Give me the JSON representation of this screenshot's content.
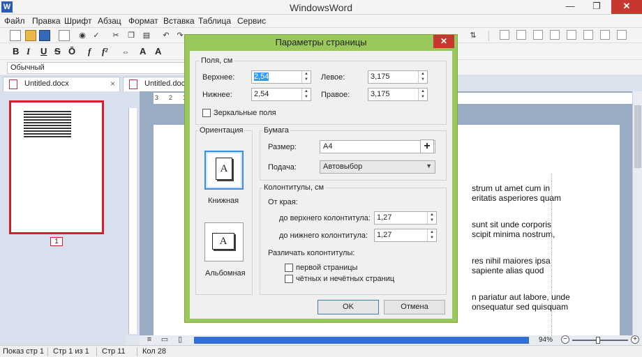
{
  "app": {
    "title": "WindowsWord",
    "icon_letter": "W"
  },
  "window_controls": {
    "minimize": "—",
    "restore": "❐",
    "close": "✕"
  },
  "menu": [
    "Файл",
    "Правка",
    "Шрифт",
    "Абзац",
    "Формат",
    "Вставка",
    "Таблица",
    "Сервис"
  ],
  "format_toolbar": {
    "bold": "B",
    "italic": "I",
    "underline": "U",
    "strike": "S",
    "overline": "Ō",
    "italic_f": "f",
    "superscript": "f²",
    "a_up": "A",
    "a_down": "A"
  },
  "style_selector": {
    "value": "Обычный"
  },
  "tabs": [
    {
      "label": "Untitled.docx",
      "close": "×"
    },
    {
      "label": "Untitled.docx"
    }
  ],
  "thumbnail": {
    "page_number": "1"
  },
  "ruler": {
    "marks": [
      "3",
      "2",
      "1"
    ]
  },
  "document": {
    "lines": [
      "strum ut amet cum in",
      "eritatis asperiores quam",
      "sunt sit unde corporis",
      "scipit minima nostrum,",
      "res nihil maiores ipsa",
      "sapiente alias quod",
      "n pariatur aut labore, unde",
      "onsequatur sed quisquam"
    ]
  },
  "zoom": {
    "label": "94%",
    "minus": "−",
    "plus": "+",
    "level_percent": 94
  },
  "status": [
    "Показ стр 1",
    "Стр 1 из 1",
    "Стр 11",
    "Кол 28"
  ],
  "dialog": {
    "title": "Параметры страницы",
    "close": "✕",
    "margins": {
      "group_label": "Поля, см",
      "top_label": "Верхнее:",
      "top_value": "2,54",
      "bottom_label": "Нижнее:",
      "bottom_value": "2,54",
      "left_label": "Левое:",
      "left_value": "3,175",
      "right_label": "Правое:",
      "right_value": "3,175",
      "mirror_label": "Зеркальные поля"
    },
    "orientation": {
      "group_label": "Ориентация",
      "portrait_label": "Книжная",
      "landscape_label": "Альбомная",
      "sheet_letter": "A"
    },
    "paper": {
      "group_label": "Бумага",
      "size_label": "Размер:",
      "size_value": "A4",
      "feed_label": "Подача:",
      "feed_value": "Автовыбор",
      "add_button": "+"
    },
    "headers": {
      "group_label": "Колонтитулы, см",
      "from_edge_label": "От края:",
      "header_label": "до верхнего колонтитула:",
      "header_value": "1,27",
      "footer_label": "до нижнего колонтитула:",
      "footer_value": "1,27",
      "distinguish_label": "Различать колонтитулы:",
      "first_page_label": "первой страницы",
      "odd_even_label": "чётных и нечётных страниц"
    },
    "ok_label": "OK",
    "cancel_label": "Отмена"
  }
}
